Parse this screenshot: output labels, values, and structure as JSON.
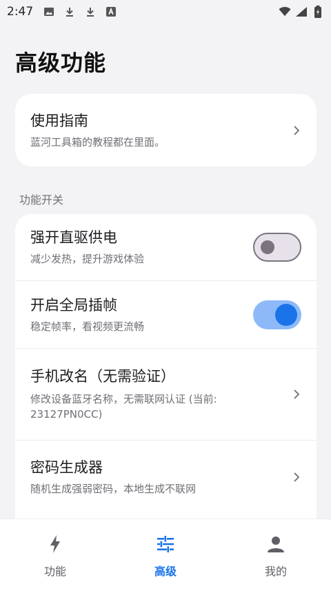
{
  "status_bar": {
    "time": "2:47",
    "icons_left": [
      "image-icon",
      "download-icon",
      "download-icon",
      "a-badge-icon"
    ],
    "icons_right": [
      "wifi-icon",
      "signal-icon",
      "battery-icon"
    ]
  },
  "page": {
    "title": "高级功能"
  },
  "guide_card": {
    "title": "使用指南",
    "subtitle": "蓝河工具箱的教程都在里面。"
  },
  "section": {
    "label": "功能开关"
  },
  "feature_rows": [
    {
      "title": "强开直驱供电",
      "subtitle": "减少发热，提升游戏体验",
      "control": "switch",
      "on": false
    },
    {
      "title": "开启全局插帧",
      "subtitle": "稳定帧率，看视频更流畅",
      "control": "switch",
      "on": true
    },
    {
      "title": "手机改名（无需验证）",
      "subtitle": "修改设备蓝牙名称，无需联网认证 (当前:",
      "subtitle2": "23127PN0CC)",
      "control": "chevron"
    },
    {
      "title": "密码生成器",
      "subtitle": "随机生成强弱密码，本地生成不联网",
      "control": "chevron"
    }
  ],
  "bottom_nav": {
    "items": [
      {
        "label": "功能",
        "icon": "bolt-icon",
        "active": false
      },
      {
        "label": "高级",
        "icon": "tune-icon",
        "active": true
      },
      {
        "label": "我的",
        "icon": "person-icon",
        "active": false
      }
    ]
  },
  "colors": {
    "accent": "#1a73e8",
    "background": "#f3f3f6",
    "card": "#ffffff",
    "switch_on_track": "#8db9f8",
    "switch_off_track": "#e7e2ea"
  }
}
